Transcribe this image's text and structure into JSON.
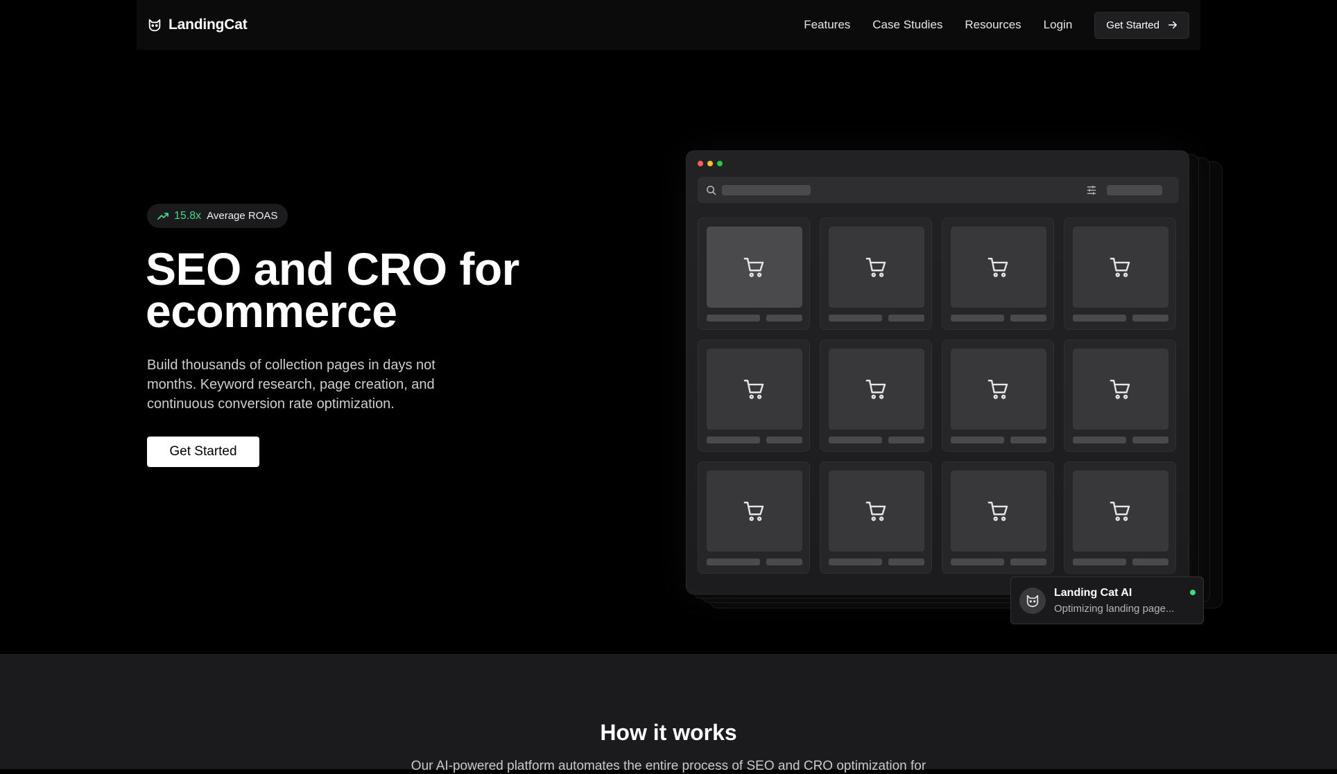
{
  "nav": {
    "logo_text": "LandingCat",
    "logo_icon": "cat-icon",
    "links": [
      "Features",
      "Case Studies",
      "Resources",
      "Login"
    ],
    "cta_label": "Get Started",
    "cta_icon": "arrow-right-icon"
  },
  "hero": {
    "badge_value": "15.8x",
    "badge_label": "Average ROAS",
    "badge_icon": "trending-up-icon",
    "title_line1": "SEO and CRO for",
    "title_line2": "ecommerce",
    "subtitle": "Build thousands of collection pages in days not months. Keyword research, page creation, and continuous conversion rate optimization.",
    "cta_label": "Get Started"
  },
  "mockup": {
    "window_dots_colors": [
      "#ff5f57",
      "#febc2e",
      "#28c840"
    ],
    "search_icon": "search-icon",
    "filter_icon": "sliders-icon",
    "product_icon": "shopping-cart-icon",
    "product_count": 12,
    "active_card_index": 0
  },
  "toast": {
    "title": "Landing Cat AI",
    "subtitle": "Optimizing landing page...",
    "icon": "cat-icon",
    "status_color": "#3ddc84"
  },
  "how": {
    "title": "How it works",
    "subtitle": "Our AI-powered platform automates the entire process of SEO and CRO optimization for"
  },
  "colors": {
    "accent_green": "#3ddc84",
    "background": "#000000"
  }
}
